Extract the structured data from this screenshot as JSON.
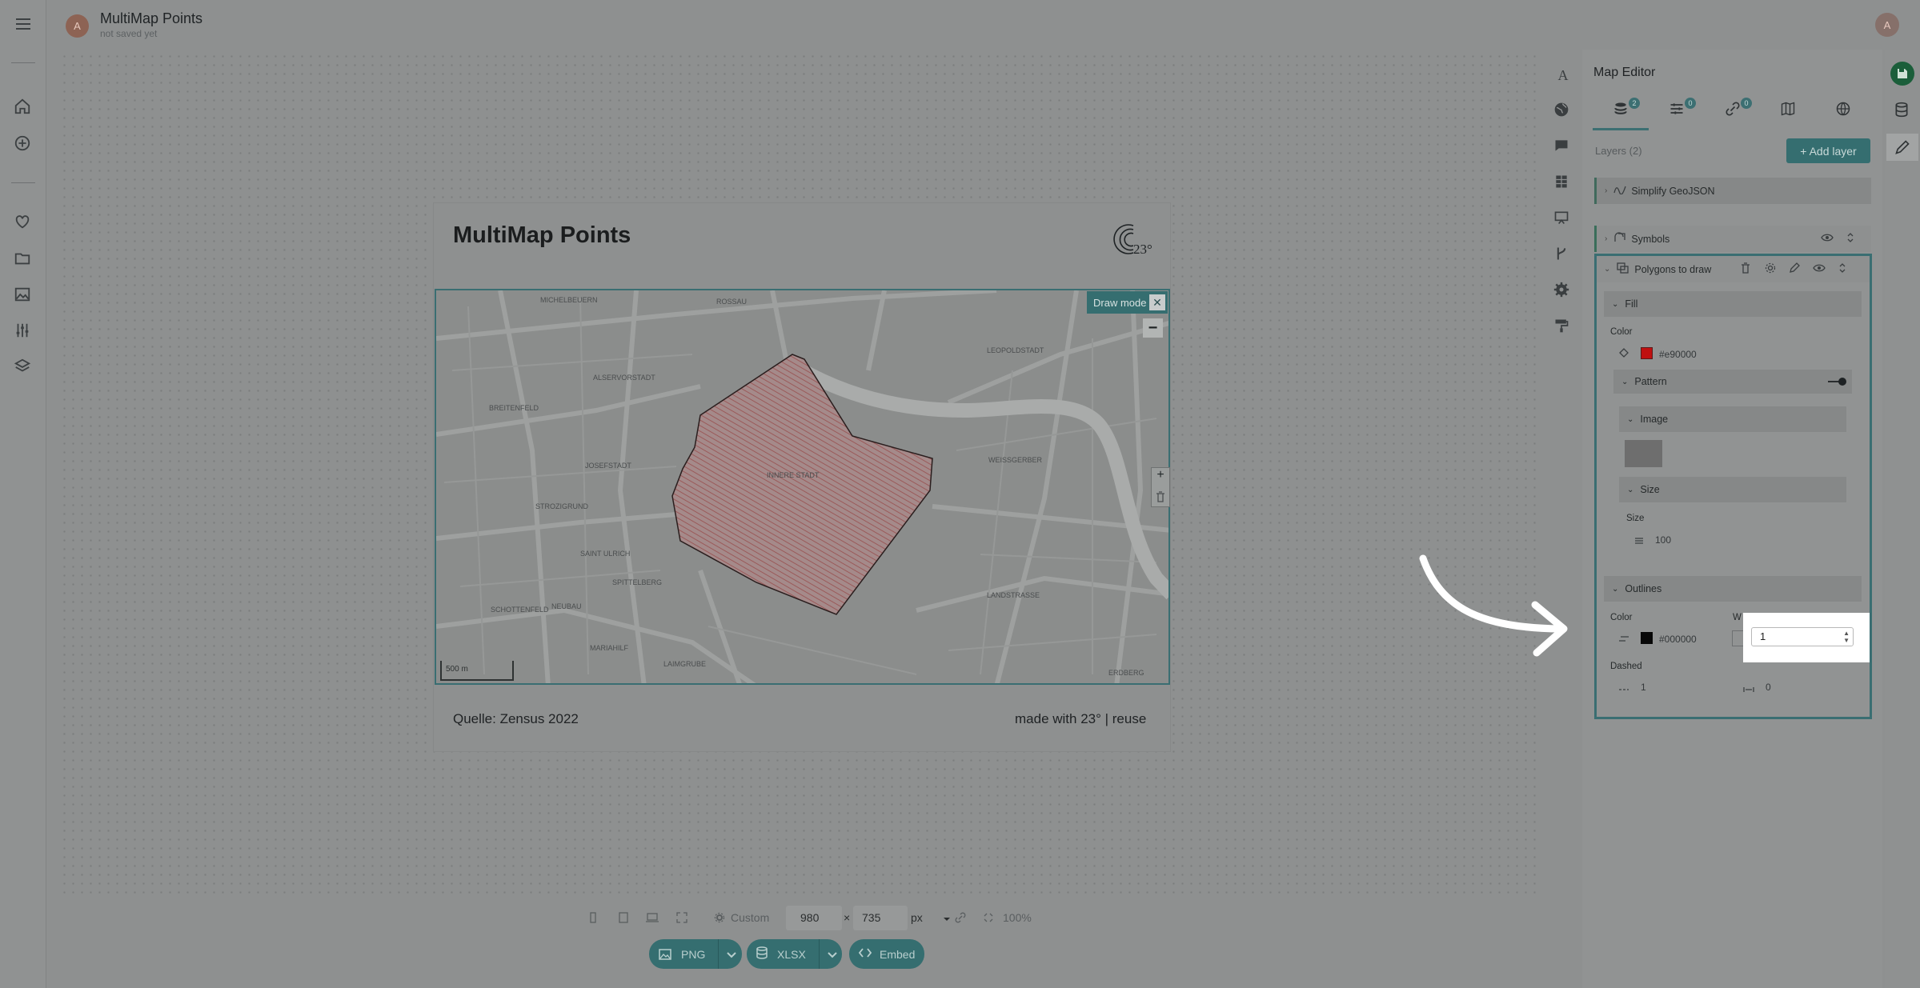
{
  "header": {
    "avatar_initial": "A",
    "title": "MultiMap Points",
    "subtitle": "not saved yet"
  },
  "card": {
    "title": "MultiMap Points",
    "logo_text": "23°",
    "draw_mode": "Draw mode",
    "draw_mode_close": "✕",
    "zoom_out": "−",
    "zoom_in": "+",
    "scale": "500 m",
    "source": "Quelle: Zensus 2022",
    "made_with": "made with 23° | reuse"
  },
  "map_labels": {
    "michelbeuern": "MICHELBEUERN",
    "rossau": "ROSSAU",
    "leopoldstadt": "LEOPOLDSTADT",
    "alservorstadt": "ALSERVORSTADT",
    "breitenfeld": "BREITENFELD",
    "josefstadt": "JOSEFSTADT",
    "innere_stadt": "INNERE STADT",
    "weissgerber": "WEISSGERBER",
    "strozigrund": "STROZIGRUND",
    "saint_ulrich": "SAINT ULRICH",
    "spittelberg": "SPITTELBERG",
    "schottenfeld": "SCHOTTENFELD",
    "neubau": "NEUBAU",
    "landstrasse": "LANDSTRASSE",
    "mariahilf": "MARIAHILF",
    "laimgrube": "LAIMGRUBE",
    "erdberg": "ERDBERG"
  },
  "toolbar": {
    "preset": "Custom",
    "width": "980",
    "times": "×",
    "height": "735",
    "unit": "px",
    "zoom": "100%",
    "png": "PNG",
    "xlsx": "XLSX",
    "embed": "Embed"
  },
  "editor": {
    "title": "Map Editor",
    "tabs": [
      {
        "name": "layers",
        "badge": "2"
      },
      {
        "name": "filters",
        "badge": "0"
      },
      {
        "name": "links",
        "badge": "0"
      },
      {
        "name": "map"
      },
      {
        "name": "globe"
      }
    ],
    "layers_label": "Layers (2)",
    "add_layer": "+ Add layer",
    "layers": [
      "Simplify GeoJSON",
      "Symbols",
      "Polygons to draw"
    ],
    "fill": {
      "section": "Fill",
      "color_label": "Color",
      "color_value": "#e90000",
      "swatch": "#c01010",
      "pattern": "Pattern",
      "image": "Image",
      "size_section": "Size",
      "size_label": "Size",
      "size_value": "100"
    },
    "outlines": {
      "section": "Outlines",
      "color_label": "Color",
      "color_value": "#000000",
      "width_label": "W",
      "width_value": "1",
      "dashed_label": "Dashed",
      "dash_value": "1",
      "gap_value": "0"
    }
  },
  "colors": {
    "accent": "#356e70",
    "overlay_bg": "#8e9090",
    "polygon_fill": "#a88686"
  }
}
